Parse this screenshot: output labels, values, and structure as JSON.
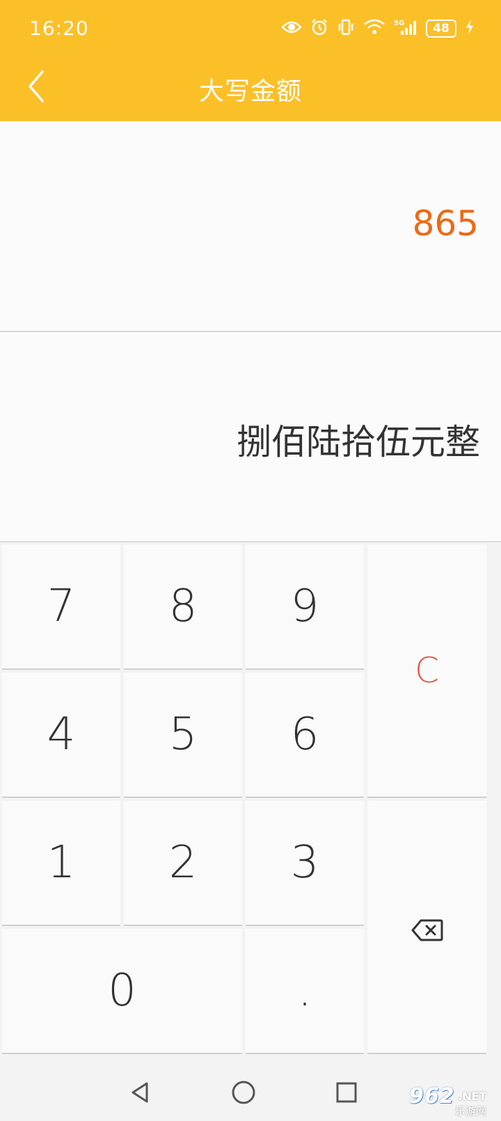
{
  "status_bar": {
    "time": "16:20",
    "battery": "48",
    "icons": [
      "eye-icon",
      "alarm-icon",
      "vibrate-icon",
      "wifi-icon",
      "5g-signal-icon",
      "battery-icon",
      "charging-icon"
    ]
  },
  "app_bar": {
    "title": "大写金额",
    "back_icon": "chevron-left-icon",
    "background": "#fbbf28"
  },
  "display": {
    "amount": "865",
    "amount_color": "#ea6b16",
    "chinese": "捌佰陆拾伍元整"
  },
  "keypad": {
    "digits": {
      "k7": "7",
      "k8": "8",
      "k9": "9",
      "k4": "4",
      "k5": "5",
      "k6": "6",
      "k1": "1",
      "k2": "2",
      "k3": "3",
      "k0": "0"
    },
    "dot": ".",
    "clear": "C",
    "clear_color": "#e25c4b",
    "backspace_icon": "backspace-icon"
  },
  "nav_bar": {
    "icons": [
      "back-triangle-icon",
      "home-circle-icon",
      "recents-square-icon"
    ]
  },
  "watermark": {
    "brand": "962",
    "suffix": ".NET",
    "sub": "乐游网"
  }
}
